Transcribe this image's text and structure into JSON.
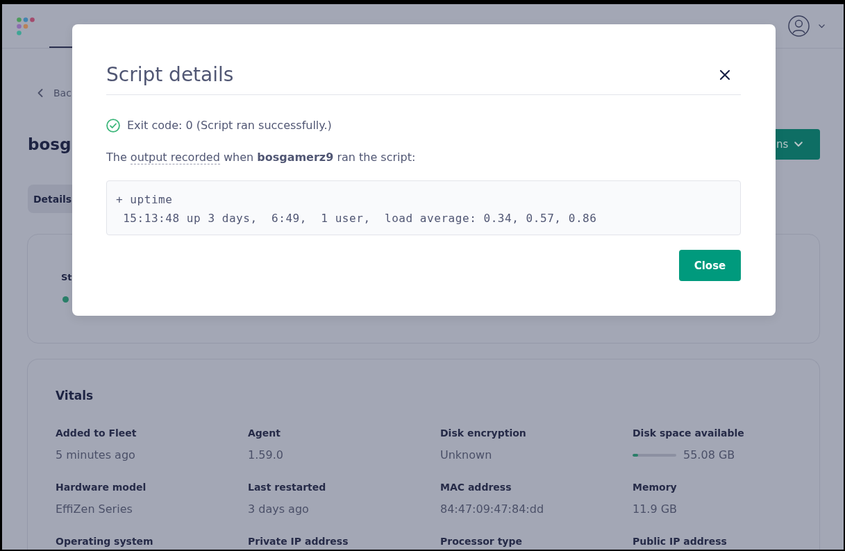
{
  "page": {
    "back_link": "Bac",
    "host_name": "bosg",
    "actions_button": "ns",
    "tabs": [
      {
        "label": "Details",
        "selected": true
      }
    ],
    "status": {
      "title": "St",
      "online": true
    }
  },
  "vitals": {
    "title": "Vitals",
    "items": [
      {
        "kind": "text",
        "label": "Added to Fleet",
        "value": "5 minutes ago"
      },
      {
        "kind": "text",
        "label": "Agent",
        "value": "1.59.0"
      },
      {
        "kind": "text",
        "label": "Disk encryption",
        "value": "Unknown"
      },
      {
        "kind": "meter",
        "label": "Disk space available",
        "value": "55.08 GB",
        "level": 0.12
      },
      {
        "kind": "text",
        "label": "Hardware model",
        "value": "EffiZen Series"
      },
      {
        "kind": "text",
        "label": "Last restarted",
        "value": "3 days ago"
      },
      {
        "kind": "text",
        "label": "MAC address",
        "value": "84:47:09:47:84:dd"
      },
      {
        "kind": "text",
        "label": "Memory",
        "value": "11.9 GB"
      },
      {
        "kind": "text",
        "label": "Operating system"
      },
      {
        "kind": "text",
        "label": "Private IP address"
      },
      {
        "kind": "text",
        "label": "Processor type"
      },
      {
        "kind": "text",
        "label": "Public IP address"
      }
    ]
  },
  "modal": {
    "title": "Script details",
    "exit_status": {
      "success": true,
      "text": "Exit code: 0 (Script ran successfully.)"
    },
    "description": {
      "before": "The",
      "tooltip": "output recorded",
      "after": "when **bosgamerz9** ran the script:"
    },
    "output": "+ uptime\n 15:13:48 up 3 days,  6:49,  1 user,  load average: 0.34, 0.57, 0.86",
    "buttons": [
      "Close"
    ]
  }
}
